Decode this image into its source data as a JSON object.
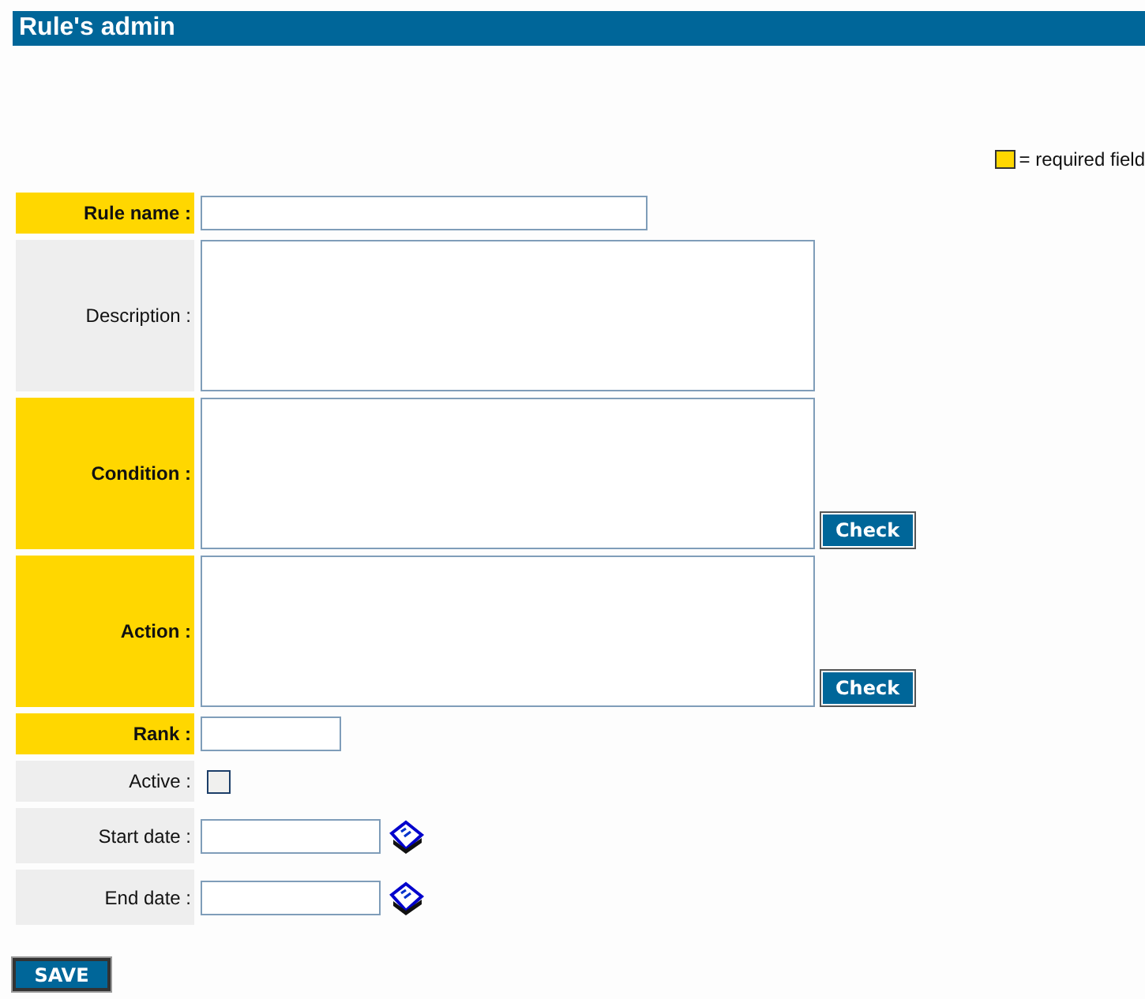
{
  "title": "Rule's admin",
  "legend": {
    "text": "= required field"
  },
  "fields": [
    {
      "label": "Rule name :",
      "required": true,
      "kind": "text"
    },
    {
      "label": "Description :",
      "required": false,
      "kind": "textarea"
    },
    {
      "label": "Condition :",
      "required": true,
      "kind": "textarea",
      "button": "Check"
    },
    {
      "label": "Action :",
      "required": true,
      "kind": "textarea",
      "button": "Check"
    },
    {
      "label": "Rank :",
      "required": true,
      "kind": "number"
    },
    {
      "label": "Active :",
      "required": false,
      "kind": "checkbox",
      "checked": false
    },
    {
      "label": "Start date :",
      "required": false,
      "kind": "date"
    },
    {
      "label": "End date :",
      "required": false,
      "kind": "date"
    }
  ],
  "save_button": "SAVE"
}
